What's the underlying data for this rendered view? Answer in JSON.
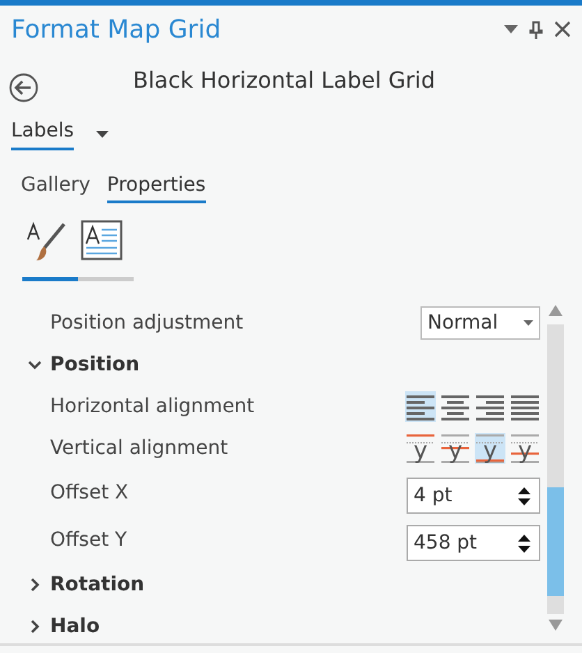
{
  "window": {
    "title": "Format Map Grid"
  },
  "subtitle": "Black Horizontal Label Grid",
  "element_dropdown": {
    "value": "Labels"
  },
  "tabs": [
    {
      "label": "Gallery",
      "selected": false
    },
    {
      "label": "Properties",
      "selected": true
    }
  ],
  "icon_tabs": [
    {
      "kind": "symbol",
      "selected": true
    },
    {
      "kind": "text",
      "selected": false
    }
  ],
  "properties": [
    {
      "kind": "dropdown",
      "label": "Position adjustment",
      "value": "Normal"
    },
    {
      "kind": "section",
      "label": "Position",
      "expanded": true
    },
    {
      "kind": "align-h",
      "label": "Horizontal alignment",
      "options": [
        {
          "kind": "left",
          "selected": true
        },
        {
          "kind": "center",
          "selected": false
        },
        {
          "kind": "right",
          "selected": false
        },
        {
          "kind": "justify",
          "selected": false
        }
      ]
    },
    {
      "kind": "align-v",
      "label": "Vertical alignment",
      "options": [
        {
          "glyph": "y",
          "kind": "top",
          "selected": false
        },
        {
          "glyph": "y",
          "kind": "center",
          "selected": false
        },
        {
          "glyph": "y",
          "kind": "bottom",
          "selected": true
        },
        {
          "glyph": "y",
          "kind": "baseline",
          "selected": false
        }
      ]
    },
    {
      "kind": "spinner",
      "label": "Offset X",
      "value": "4 pt"
    },
    {
      "kind": "spinner",
      "label": "Offset Y",
      "value": "458 pt"
    },
    {
      "kind": "section",
      "label": "Rotation",
      "expanded": false
    },
    {
      "kind": "section",
      "label": "Halo",
      "expanded": false
    }
  ]
}
